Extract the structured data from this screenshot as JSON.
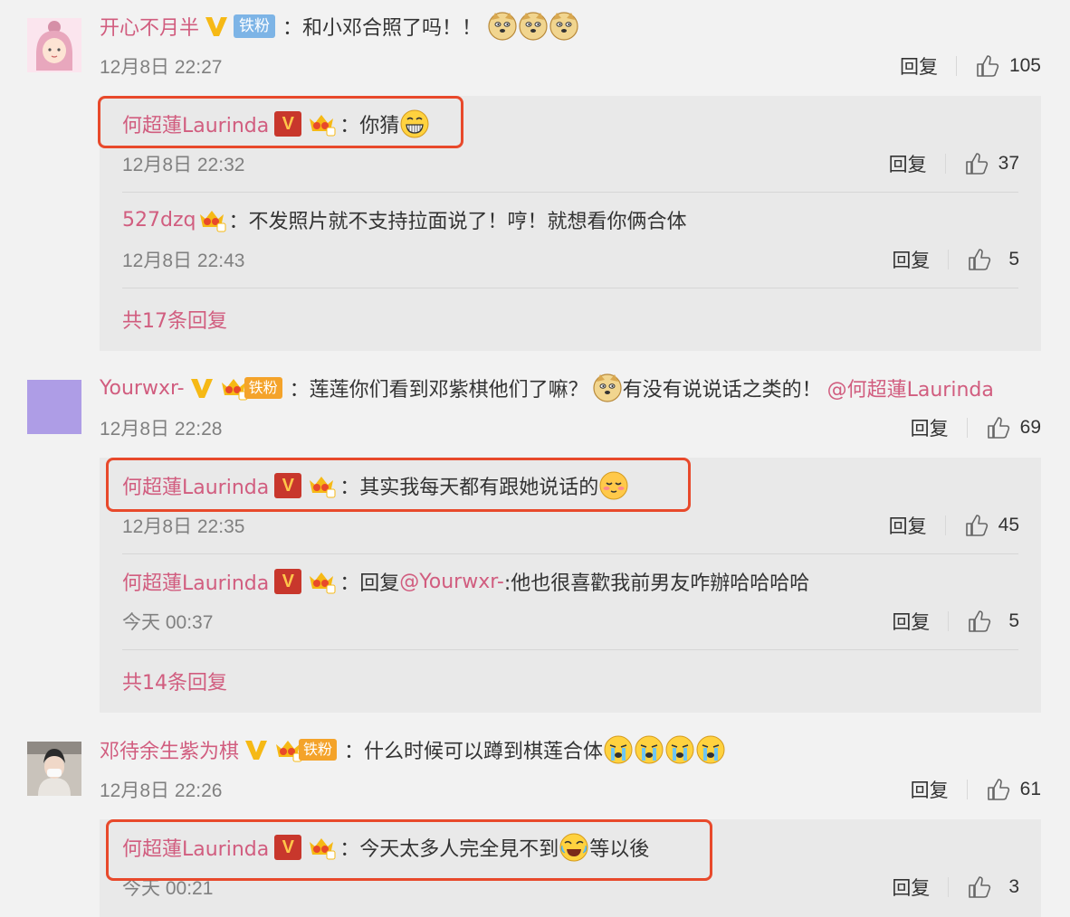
{
  "comments": [
    {
      "user": "开心不月半",
      "fan_label": "铁粉",
      "text": "：和小邓合照了吗！！",
      "time": "12月8日 22:27",
      "reply_label": "回复",
      "likes": "105",
      "replies": [
        {
          "user": "何超蓮Laurinda",
          "text": "：你猜",
          "time": "12月8日 22:32",
          "reply_label": "回复",
          "likes": "37"
        },
        {
          "user": "527dzq",
          "text": "：不发照片就不支持拉面说了！哼！就想看你俩合体",
          "time": "12月8日 22:43",
          "reply_label": "回复",
          "likes": "5"
        }
      ],
      "more": "共17条回复"
    },
    {
      "user": "Yourwxr-",
      "fan_label": "铁粉",
      "text_a": "：莲莲你们看到邓紫棋他们了嘛？",
      "text_b": "有没有说说话之类的！",
      "mention": "@何超蓮Laurinda",
      "time": "12月8日 22:28",
      "reply_label": "回复",
      "likes": "69",
      "replies": [
        {
          "user": "何超蓮Laurinda",
          "text": "：其实我每天都有跟她说话的",
          "time": "12月8日 22:35",
          "reply_label": "回复",
          "likes": "45"
        },
        {
          "user": "何超蓮Laurinda",
          "text_a": "：回复",
          "mention": "@Yourwxr-",
          "text_b": ":他也很喜歡我前男友咋辦哈哈哈哈",
          "time": "今天 00:37",
          "reply_label": "回复",
          "likes": "5"
        }
      ],
      "more": "共14条回复"
    },
    {
      "user": "邓待余生紫为棋",
      "fan_label": "铁粉",
      "text": "：什么时候可以蹲到棋莲合体",
      "time": "12月8日 22:26",
      "reply_label": "回复",
      "likes": "61",
      "replies": [
        {
          "user": "何超蓮Laurinda",
          "text_a": "：今天太多人完全見不到",
          "text_b": "等以後",
          "time": "今天 00:21",
          "reply_label": "回复",
          "likes": "3"
        }
      ]
    }
  ],
  "badges": {
    "verified": "V"
  },
  "colors": {
    "username": "#d15d7f",
    "highlight": "#e8492b",
    "verified_red": "#c8372c"
  },
  "icons": {
    "thumb": "thumbs-up-icon",
    "doge": "doge-emoji",
    "grin": "grin-emoji",
    "shy": "shy-emoji",
    "cry": "crying-emoji",
    "laughcry": "laugh-cry-emoji"
  }
}
